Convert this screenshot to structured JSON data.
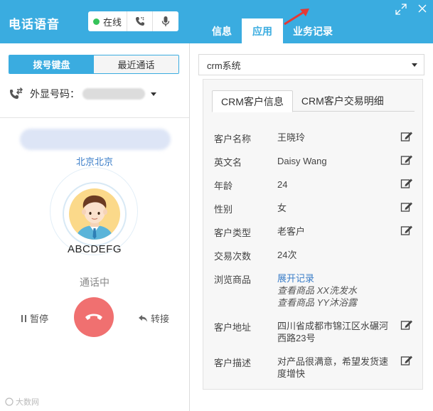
{
  "left": {
    "title": "电话语音",
    "status_label": "在线",
    "tabs": [
      "拨号键盘",
      "最近通话"
    ],
    "caller_id_label": "外显号码：",
    "location": "北京北京",
    "caller_name": "ABCDEFG",
    "call_state": "通话中",
    "pause_label": "暂停",
    "transfer_label": "转接",
    "watermark": "大数网"
  },
  "right": {
    "tabs": [
      "信息",
      "应用",
      "业务记录"
    ],
    "active_tab": "应用",
    "system_select": "crm系统",
    "inner_tabs": [
      "CRM客户信息",
      "CRM客户交易明细"
    ],
    "fields": [
      {
        "label": "客户名称",
        "value": "王晓玲",
        "editable": true
      },
      {
        "label": "英文名",
        "value": "Daisy Wang",
        "editable": true
      },
      {
        "label": "年龄",
        "value": "24",
        "editable": true
      },
      {
        "label": "性别",
        "value": "女",
        "editable": true
      },
      {
        "label": "客户类型",
        "value": "老客户",
        "editable": true
      },
      {
        "label": "交易次数",
        "value": "24次",
        "editable": false
      },
      {
        "label": "浏览商品",
        "value": "展开记录",
        "items": [
          "查看商品 XX洗发水",
          "查看商品 YY沐浴露"
        ],
        "editable": false
      },
      {
        "label": "客户地址",
        "value_lines": [
          "四川省成都市锦江区水碾河",
          "西路23号"
        ],
        "editable": true
      },
      {
        "label": "客户描述",
        "value_lines": [
          "对产品很满意，希望发货速",
          "度增快"
        ],
        "editable": true
      }
    ]
  },
  "colors": {
    "brand": "#3aace0",
    "online": "#35c35a",
    "hangup": "#f07070",
    "link": "#3a7dc8",
    "arrow": "#e53935"
  }
}
